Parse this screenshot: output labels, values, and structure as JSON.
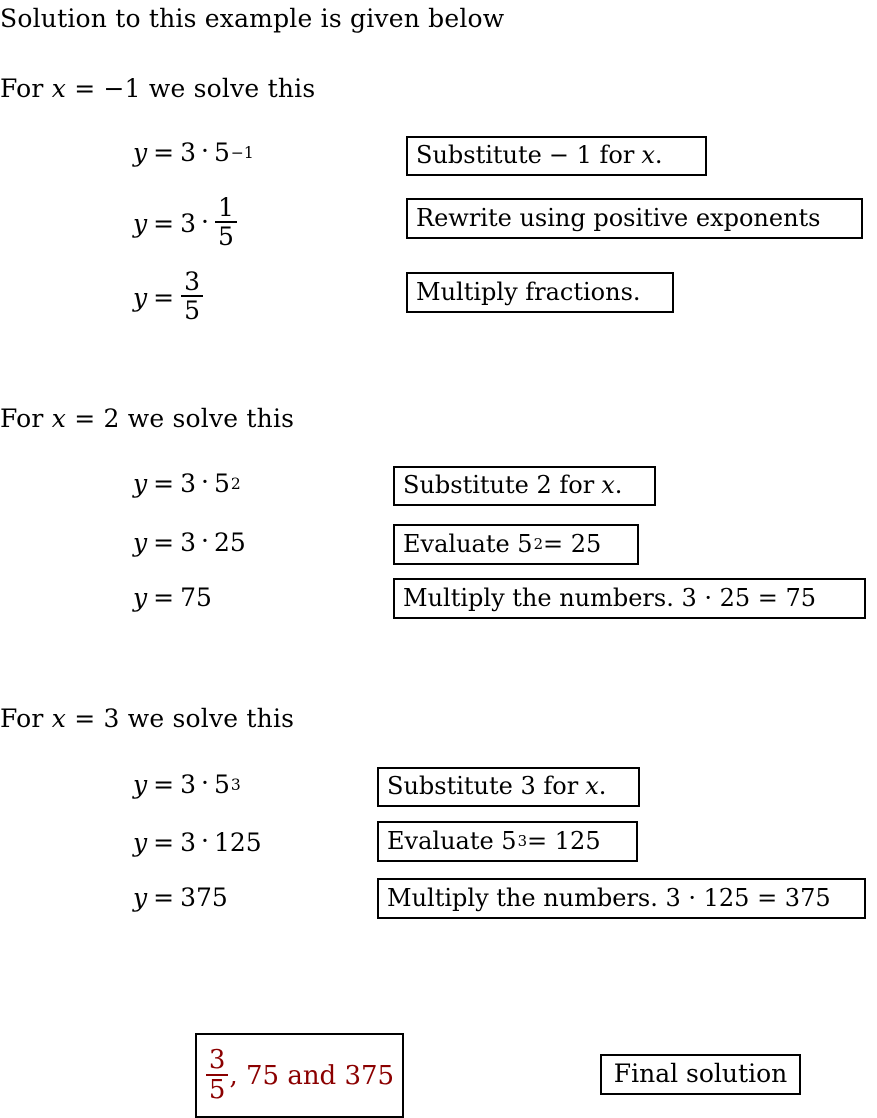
{
  "document": {
    "intro_line": "Solution to this example is given below",
    "accent_color": "#8B0000",
    "border_color": "#000000",
    "background_color": "#FFFFFF"
  },
  "sections": [
    {
      "heading_prefix": "For ",
      "heading_var": "x",
      "heading_eq": " = −1 we solve this",
      "x_value": "−1",
      "equations": [
        {
          "lhs": "y",
          "eq": "=",
          "a": "3",
          "dot": "·",
          "base": "5",
          "exp": "−1"
        },
        {
          "lhs": "y",
          "eq": "=",
          "a": "3",
          "dot": "·",
          "frac_num": "1",
          "frac_den": "5"
        },
        {
          "lhs": "y",
          "eq": "=",
          "frac_num": "3",
          "frac_den": "5"
        }
      ],
      "notes": [
        {
          "text_a": "Substitute",
          "text_b": "− 1 for",
          "text_var": "x",
          "text_c": "."
        },
        {
          "text_a": "Rewrite using positive exponents",
          "text_b": "",
          "text_var": "",
          "text_c": ""
        },
        {
          "text_a": "Multiply fractions.",
          "text_b": "",
          "text_var": "",
          "text_c": ""
        }
      ]
    },
    {
      "heading_prefix": "For ",
      "heading_var": "x",
      "heading_eq": " = 2 we solve this",
      "x_value": "2",
      "equations": [
        {
          "lhs": "y",
          "eq": "=",
          "a": "3",
          "dot": "·",
          "base": "5",
          "exp": "2"
        },
        {
          "lhs": "y",
          "eq": "=",
          "a": "3",
          "dot": "·",
          "b": "25"
        },
        {
          "lhs": "y",
          "eq": "=",
          "a": "75"
        }
      ],
      "notes": [
        {
          "text_a": "Substitute 2 for",
          "text_b": "",
          "text_var": "x",
          "text_c": "."
        },
        {
          "text_a": "Evaluate 5",
          "sup": "2",
          "text_b": " = 25",
          "text_var": "",
          "text_c": ""
        },
        {
          "text_a": "Multiply the numbers.  3 · 25 = 75",
          "text_b": "",
          "text_var": "",
          "text_c": ""
        }
      ]
    },
    {
      "heading_prefix": "For ",
      "heading_var": "x",
      "heading_eq": " = 3 we solve this",
      "x_value": "3",
      "equations": [
        {
          "lhs": "y",
          "eq": "=",
          "a": "3",
          "dot": "·",
          "base": "5",
          "exp": "3"
        },
        {
          "lhs": "y",
          "eq": "=",
          "a": "3",
          "dot": "·",
          "b": "125"
        },
        {
          "lhs": "y",
          "eq": "=",
          "a": "375"
        }
      ],
      "notes": [
        {
          "text_a": "Substitute 3 for",
          "text_b": "",
          "text_var": "x",
          "text_c": "."
        },
        {
          "text_a": "Evaluate 5",
          "sup": "3",
          "text_b": " = 125",
          "text_var": "",
          "text_c": ""
        },
        {
          "text_a": "Multiply the numbers.  3 · 125 = 375",
          "text_b": "",
          "text_var": "",
          "text_c": ""
        }
      ]
    }
  ],
  "final": {
    "answer_frac_num": "3",
    "answer_frac_den": "5",
    "answer_rest": ", 75 and 375",
    "label": "Final solution"
  }
}
